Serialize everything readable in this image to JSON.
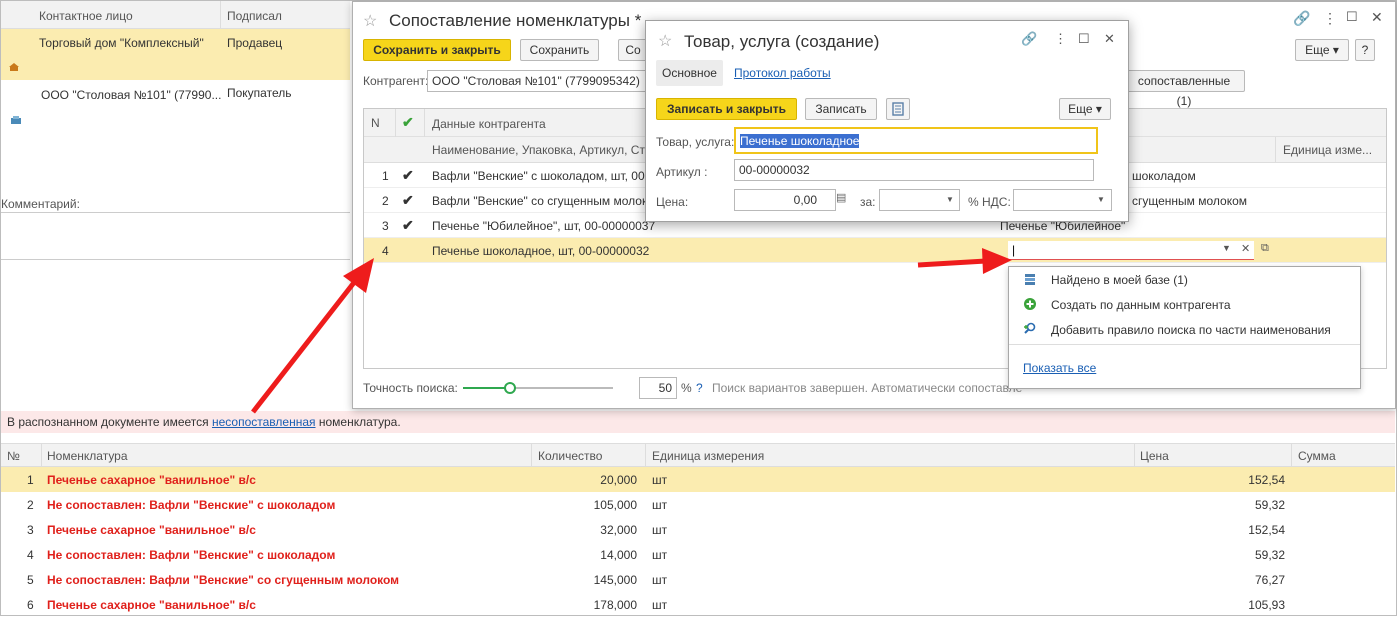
{
  "colors": {
    "accent_yellow": "#f6d51a",
    "selected_row": "#fbecb0",
    "error_red": "#e0201b",
    "link_blue": "#1a5fb4",
    "check_green": "#3aa33a",
    "arrow_red": "#ee1c1c"
  },
  "left_panel": {
    "col_contact": "Контактное лицо",
    "col_signed": "Подписал",
    "rows": [
      {
        "name": "Торговый дом \"Комплексный\"",
        "role": "Продавец",
        "icon": "home-icon"
      },
      {
        "name": "ООО \"Столовая №101\" (77990...",
        "role": "Покупатель",
        "icon": "building-icon"
      }
    ],
    "comment_label": "Комментарий:"
  },
  "notice": {
    "prefix": "В распознанном документе имеется ",
    "link": "несопоставленная",
    "suffix": " номенклатура."
  },
  "bottom_table": {
    "headers": [
      "№",
      "Номенклатура",
      "Количество",
      "Единица измерения",
      "Цена",
      "Сумма"
    ],
    "rows": [
      {
        "n": "1",
        "name": "Печенье сахарное \"ванильное\" в/с",
        "qty": "20,000",
        "unit": "шт",
        "price": "152,54"
      },
      {
        "n": "2",
        "name": "Не сопоставлен: Вафли \"Венские\" с шоколадом",
        "qty": "105,000",
        "unit": "шт",
        "price": "59,32"
      },
      {
        "n": "3",
        "name": "Печенье сахарное \"ванильное\" в/с",
        "qty": "32,000",
        "unit": "шт",
        "price": "152,54"
      },
      {
        "n": "4",
        "name": "Не сопоставлен: Вафли \"Венские\" с шоколадом",
        "qty": "14,000",
        "unit": "шт",
        "price": "59,32"
      },
      {
        "n": "5",
        "name": "Не сопоставлен: Вафли \"Венские\" со сгущенным молоком",
        "qty": "145,000",
        "unit": "шт",
        "price": "76,27"
      },
      {
        "n": "6",
        "name": "Печенье сахарное \"ванильное\" в/с",
        "qty": "178,000",
        "unit": "шт",
        "price": "105,93"
      }
    ]
  },
  "main_window": {
    "title": "Сопоставление номенклатуры *",
    "save_close": "Сохранить и закрыть",
    "save": "Сохранить",
    "third_btn": "Со",
    "more": "Еще",
    "mapped_btn": "сопоставленные (1)",
    "contractor_label": "Контрагент:",
    "contractor_value": "ООО \"Столовая №101\" (7799095342)",
    "grid": {
      "col_n": "N",
      "col_data": "Данные контрагента",
      "col_data_sub": "Наименование, Упаковка, Артикул, Став",
      "col_unit": "Единица изме...",
      "rows": [
        {
          "n": "1",
          "check": "✔",
          "data": "Вафли \"Венские\" с шоколадом, шт, 00-0",
          "match": "шоколадом"
        },
        {
          "n": "2",
          "check": "✔",
          "data": "Вафли \"Венские\" со сгущенным молоко",
          "match": "сгущенным молоком"
        },
        {
          "n": "3",
          "check": "✔",
          "data": "Печенье \"Юбилейное\", шт, 00-00000037",
          "match": "Печенье \"Юбилейное\""
        },
        {
          "n": "4",
          "check": "",
          "data": "Печенье шоколадное, шт, 00-00000032",
          "match": ""
        }
      ]
    },
    "accuracy_label": "Точность поиска:",
    "accuracy_value": "50",
    "percent": "%",
    "help": "?",
    "status": "Поиск вариантов завершен. Автоматически сопоставле"
  },
  "dropdown": {
    "items": [
      {
        "label": "Найдено в моей базе (1)",
        "icon": "database-icon"
      },
      {
        "label": "Создать по данным контрагента",
        "icon": "plus-circle-icon"
      },
      {
        "label": "Добавить правило поиска по части наименования",
        "icon": "search-add-icon"
      }
    ],
    "show_all": "Показать все"
  },
  "modal": {
    "title": "Товар, услуга (создание)",
    "tab_main": "Основное",
    "tab_log": "Протокол работы",
    "write_close": "Записать и закрыть",
    "write": "Записать",
    "more": "Еще",
    "product_label": "Товар, услуга:",
    "product_value": "Печенье шоколадное",
    "article_label": "Артикул :",
    "article_value": "00-00000032",
    "price_label": "Цена:",
    "price_value": "0,00",
    "per_label": "за:",
    "vat_label": "% НДС:"
  }
}
